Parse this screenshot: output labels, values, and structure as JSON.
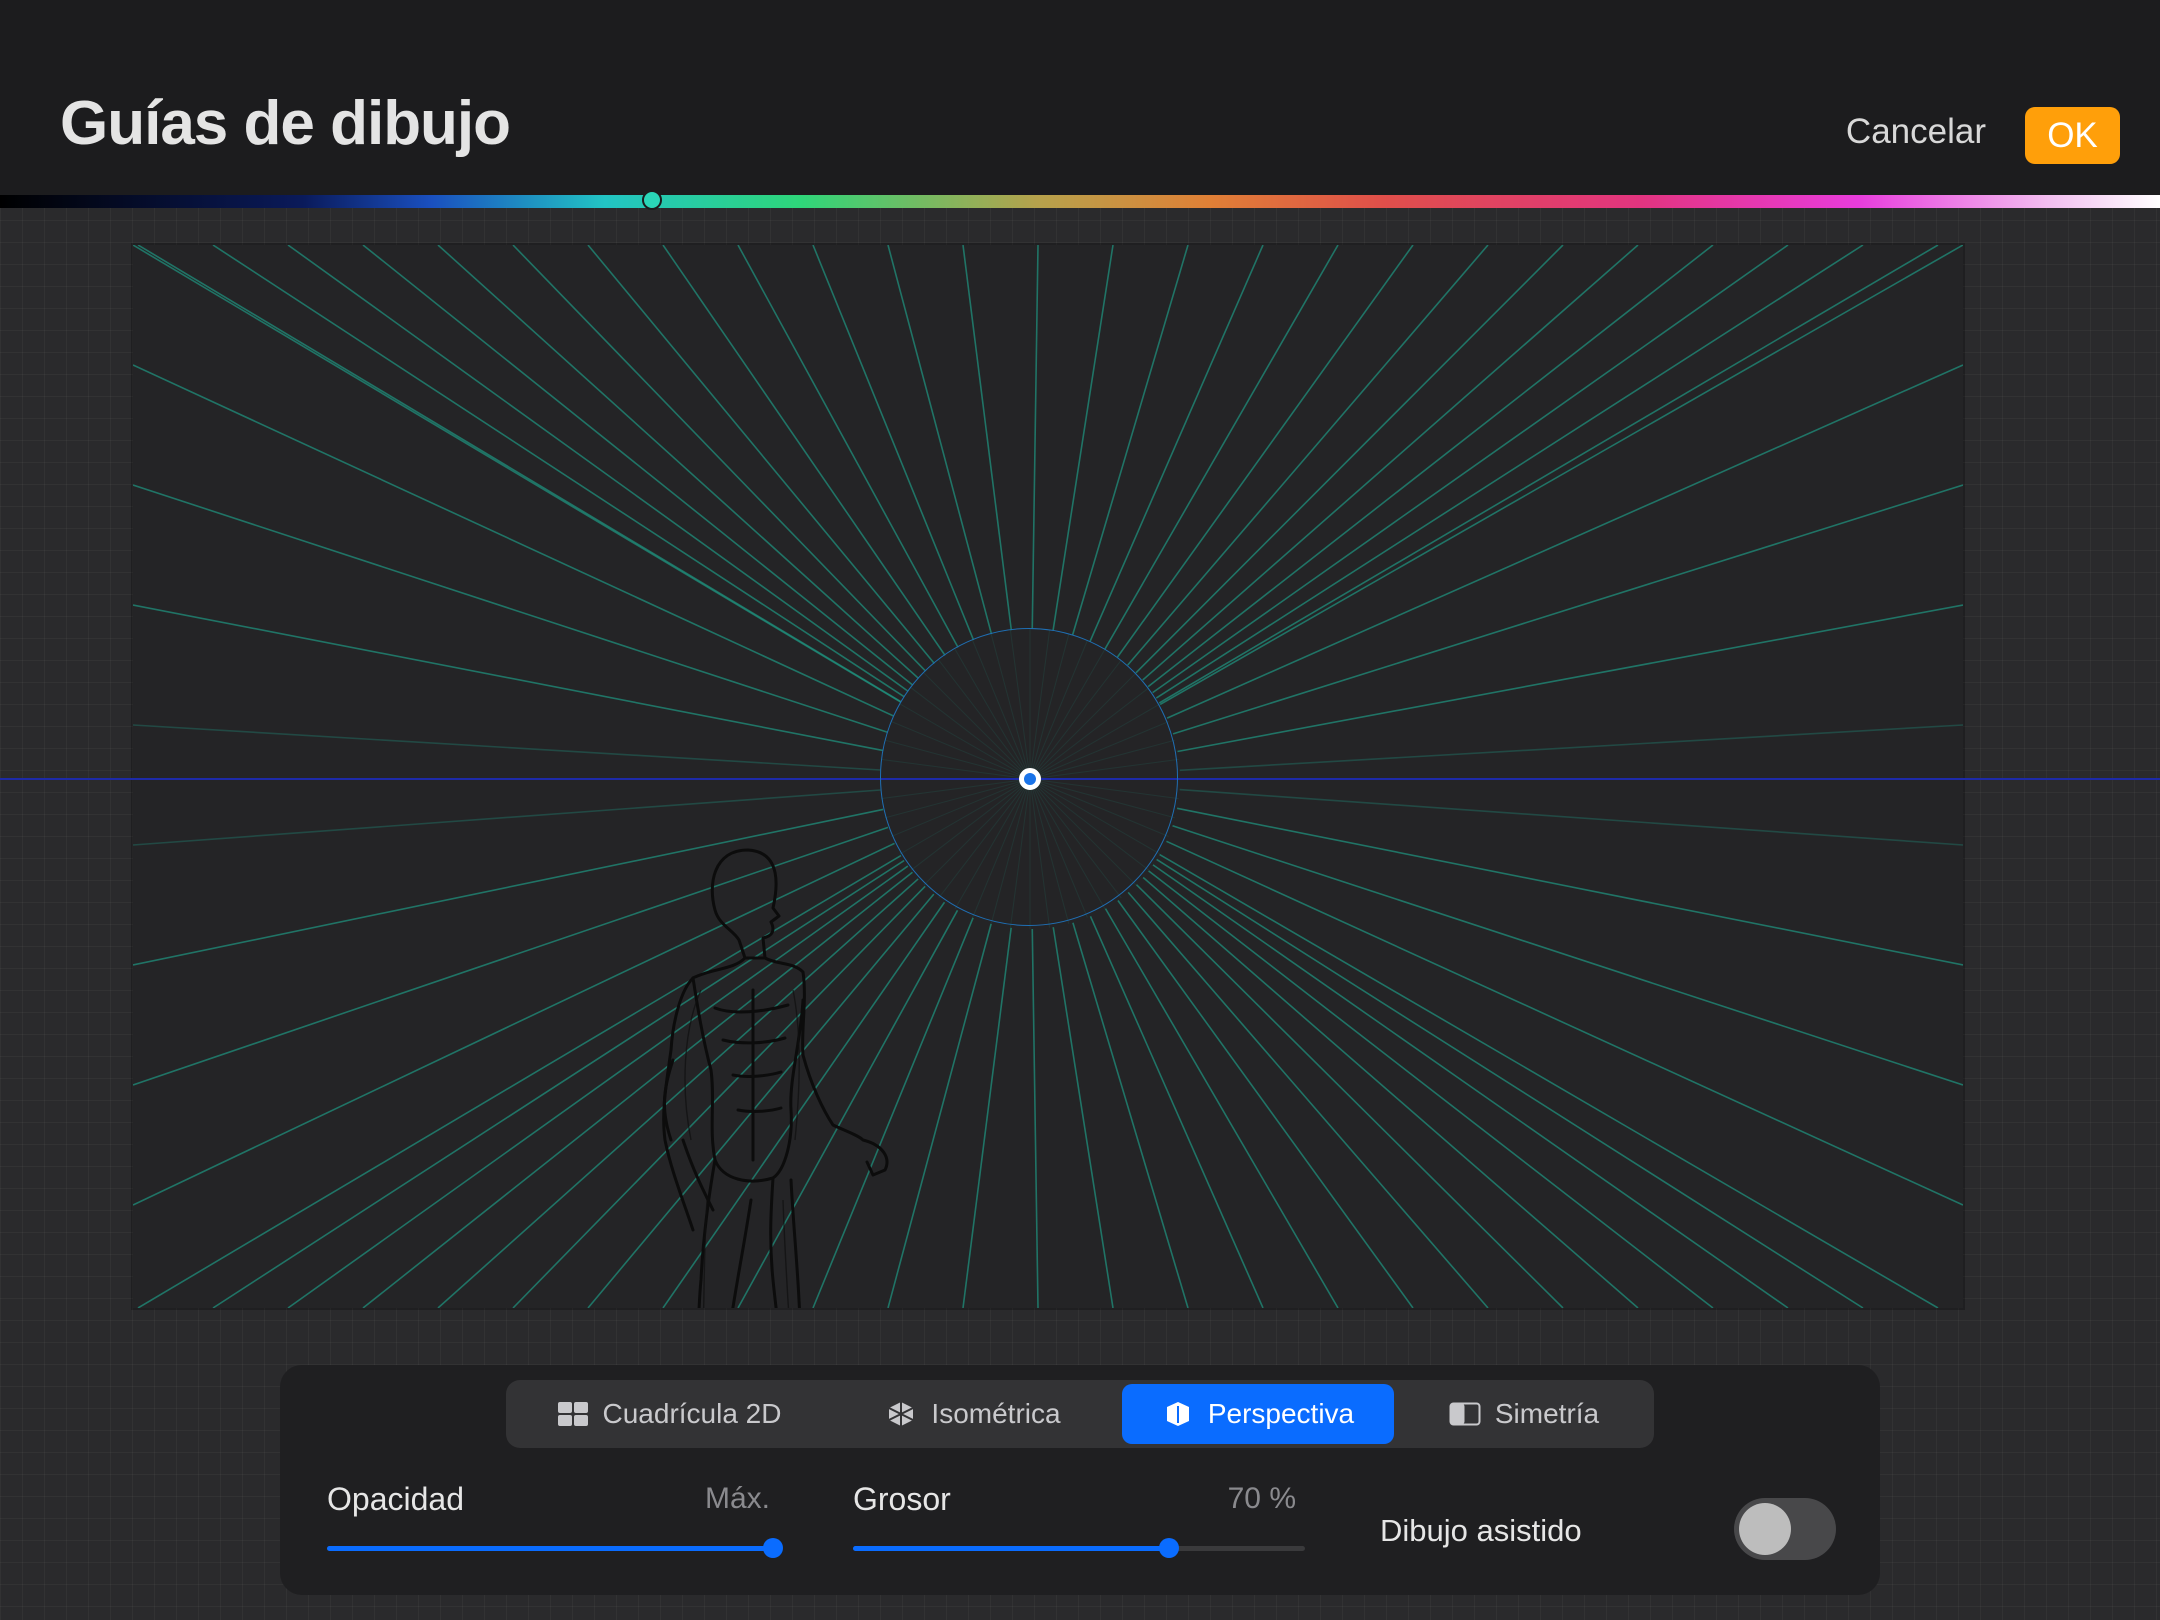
{
  "header": {
    "title": "Guías de dibujo",
    "cancel_label": "Cancelar",
    "ok_label": "OK"
  },
  "colors": {
    "accent": "#0a6cff",
    "ok_button": "#ff9f0a",
    "guide_lines": "#1f8f7c",
    "horizon": "#1d2aa8"
  },
  "tabs": [
    {
      "label": "Cuadrícula 2D",
      "icon": "grid-icon",
      "active": false
    },
    {
      "label": "Isométrica",
      "icon": "isometric-cube-icon",
      "active": false
    },
    {
      "label": "Perspectiva",
      "icon": "perspective-cube-icon",
      "active": true
    },
    {
      "label": "Simetría",
      "icon": "symmetry-icon",
      "active": false
    }
  ],
  "controls": {
    "opacity": {
      "label": "Opacidad",
      "value_text": "Máx.",
      "level": 1.0
    },
    "thickness": {
      "label": "Grosor",
      "value_text": "70 %",
      "level": 0.7
    },
    "assisted": {
      "label": "Dibujo asistido",
      "enabled": false
    }
  }
}
